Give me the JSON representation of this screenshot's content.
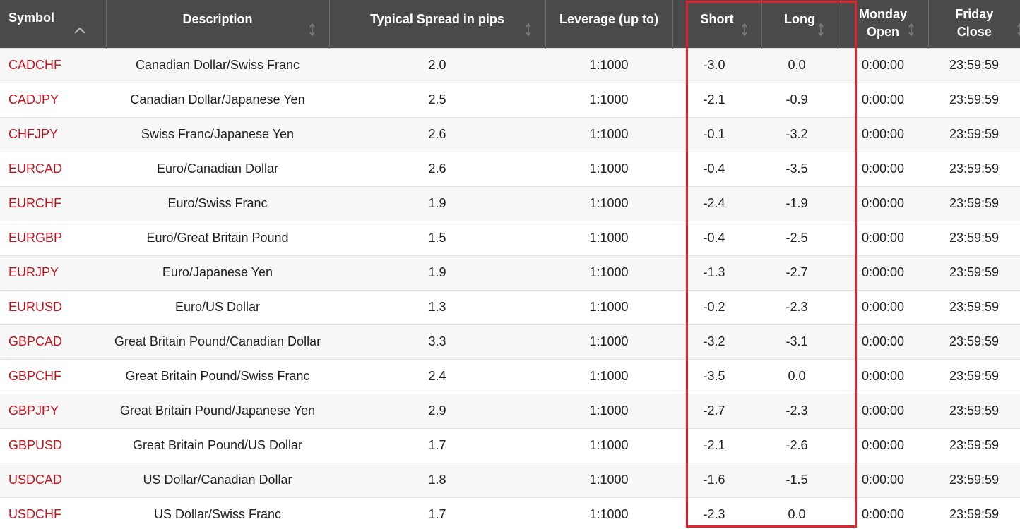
{
  "table": {
    "headers": {
      "symbol": "Symbol",
      "description": "Description",
      "spread": "Typical Spread in pips",
      "leverage": "Leverage (up to)",
      "short": "Short",
      "long": "Long",
      "monday_open_line1": "Monday",
      "monday_open_line2": "Open",
      "friday_close_line1": "Friday",
      "friday_close_line2": "Close"
    },
    "icons": {
      "symbol_sort": "sort-ascending-icon",
      "other_sort": "sort-updown-icon"
    },
    "colors": {
      "header_bg": "#4a4a4a",
      "symbol_text": "#c0161f",
      "highlight_border": "#e0232c"
    },
    "rows": [
      {
        "symbol": "CADCHF",
        "description": "Canadian Dollar/Swiss Franc",
        "spread": "2.0",
        "leverage": "1:1000",
        "short": "-3.0",
        "long": "0.0",
        "open": "0:00:00",
        "close": "23:59:59"
      },
      {
        "symbol": "CADJPY",
        "description": "Canadian Dollar/Japanese Yen",
        "spread": "2.5",
        "leverage": "1:1000",
        "short": "-2.1",
        "long": "-0.9",
        "open": "0:00:00",
        "close": "23:59:59"
      },
      {
        "symbol": "CHFJPY",
        "description": "Swiss Franc/Japanese Yen",
        "spread": "2.6",
        "leverage": "1:1000",
        "short": "-0.1",
        "long": "-3.2",
        "open": "0:00:00",
        "close": "23:59:59"
      },
      {
        "symbol": "EURCAD",
        "description": "Euro/Canadian Dollar",
        "spread": "2.6",
        "leverage": "1:1000",
        "short": "-0.4",
        "long": "-3.5",
        "open": "0:00:00",
        "close": "23:59:59"
      },
      {
        "symbol": "EURCHF",
        "description": "Euro/Swiss Franc",
        "spread": "1.9",
        "leverage": "1:1000",
        "short": "-2.4",
        "long": "-1.9",
        "open": "0:00:00",
        "close": "23:59:59"
      },
      {
        "symbol": "EURGBP",
        "description": "Euro/Great Britain Pound",
        "spread": "1.5",
        "leverage": "1:1000",
        "short": "-0.4",
        "long": "-2.5",
        "open": "0:00:00",
        "close": "23:59:59"
      },
      {
        "symbol": "EURJPY",
        "description": "Euro/Japanese Yen",
        "spread": "1.9",
        "leverage": "1:1000",
        "short": "-1.3",
        "long": "-2.7",
        "open": "0:00:00",
        "close": "23:59:59"
      },
      {
        "symbol": "EURUSD",
        "description": "Euro/US Dollar",
        "spread": "1.3",
        "leverage": "1:1000",
        "short": "-0.2",
        "long": "-2.3",
        "open": "0:00:00",
        "close": "23:59:59"
      },
      {
        "symbol": "GBPCAD",
        "description": "Great Britain Pound/Canadian Dollar",
        "spread": "3.3",
        "leverage": "1:1000",
        "short": "-3.2",
        "long": "-3.1",
        "open": "0:00:00",
        "close": "23:59:59"
      },
      {
        "symbol": "GBPCHF",
        "description": "Great Britain Pound/Swiss Franc",
        "spread": "2.4",
        "leverage": "1:1000",
        "short": "-3.5",
        "long": "0.0",
        "open": "0:00:00",
        "close": "23:59:59"
      },
      {
        "symbol": "GBPJPY",
        "description": "Great Britain Pound/Japanese Yen",
        "spread": "2.9",
        "leverage": "1:1000",
        "short": "-2.7",
        "long": "-2.3",
        "open": "0:00:00",
        "close": "23:59:59"
      },
      {
        "symbol": "GBPUSD",
        "description": "Great Britain Pound/US Dollar",
        "spread": "1.7",
        "leverage": "1:1000",
        "short": "-2.1",
        "long": "-2.6",
        "open": "0:00:00",
        "close": "23:59:59"
      },
      {
        "symbol": "USDCAD",
        "description": "US Dollar/Canadian Dollar",
        "spread": "1.8",
        "leverage": "1:1000",
        "short": "-1.6",
        "long": "-1.5",
        "open": "0:00:00",
        "close": "23:59:59"
      },
      {
        "symbol": "USDCHF",
        "description": "US Dollar/Swiss Franc",
        "spread": "1.7",
        "leverage": "1:1000",
        "short": "-2.3",
        "long": "0.0",
        "open": "0:00:00",
        "close": "23:59:59"
      }
    ]
  }
}
